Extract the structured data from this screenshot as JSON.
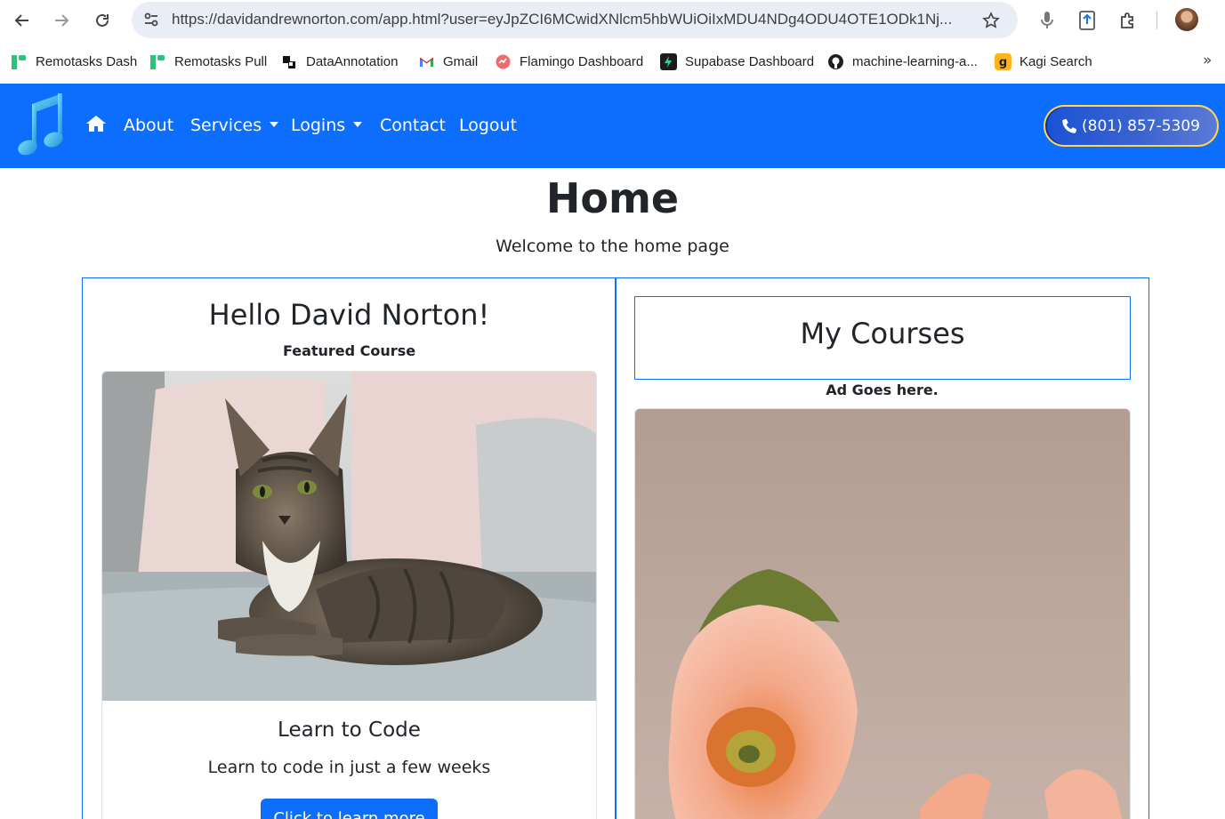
{
  "browser": {
    "url": "https://davidandrewnorton.com/app.html?user=eyJpZCI6MCwidXNlcm5hbWUiOiIxMDU4NDg4ODU4OTE1ODk1Nj...",
    "bookmarks": [
      {
        "label": "Remotasks Dash",
        "icon": "remotasks-icon"
      },
      {
        "label": "Remotasks Pull",
        "icon": "remotasks-icon"
      },
      {
        "label": "DataAnnotation",
        "icon": "dataannotation-icon"
      },
      {
        "label": "Gmail",
        "icon": "gmail-icon"
      },
      {
        "label": "Flamingo Dashboard",
        "icon": "flamingo-icon"
      },
      {
        "label": "Supabase Dashboard",
        "icon": "supabase-icon"
      },
      {
        "label": "machine-learning-a...",
        "icon": "github-icon"
      },
      {
        "label": "Kagi Search",
        "icon": "kagi-icon"
      }
    ],
    "more_label": "»"
  },
  "navbar": {
    "links": {
      "about": "About",
      "services": "Services",
      "logins": "Logins",
      "contact": "Contact",
      "logout": "Logout"
    },
    "phone": "(801) 857-5309",
    "brand_color": "#0d6efd"
  },
  "page": {
    "title": "Home",
    "subtitle": "Welcome to the home page"
  },
  "left_panel": {
    "greeting": "Hello David Norton!",
    "featured_label": "Featured Course",
    "card": {
      "title": "Learn to Code",
      "text": "Learn to code in just a few weeks",
      "button": "Click to learn more"
    }
  },
  "right_panel": {
    "title": "My Courses",
    "ad_text": "Ad Goes here."
  }
}
